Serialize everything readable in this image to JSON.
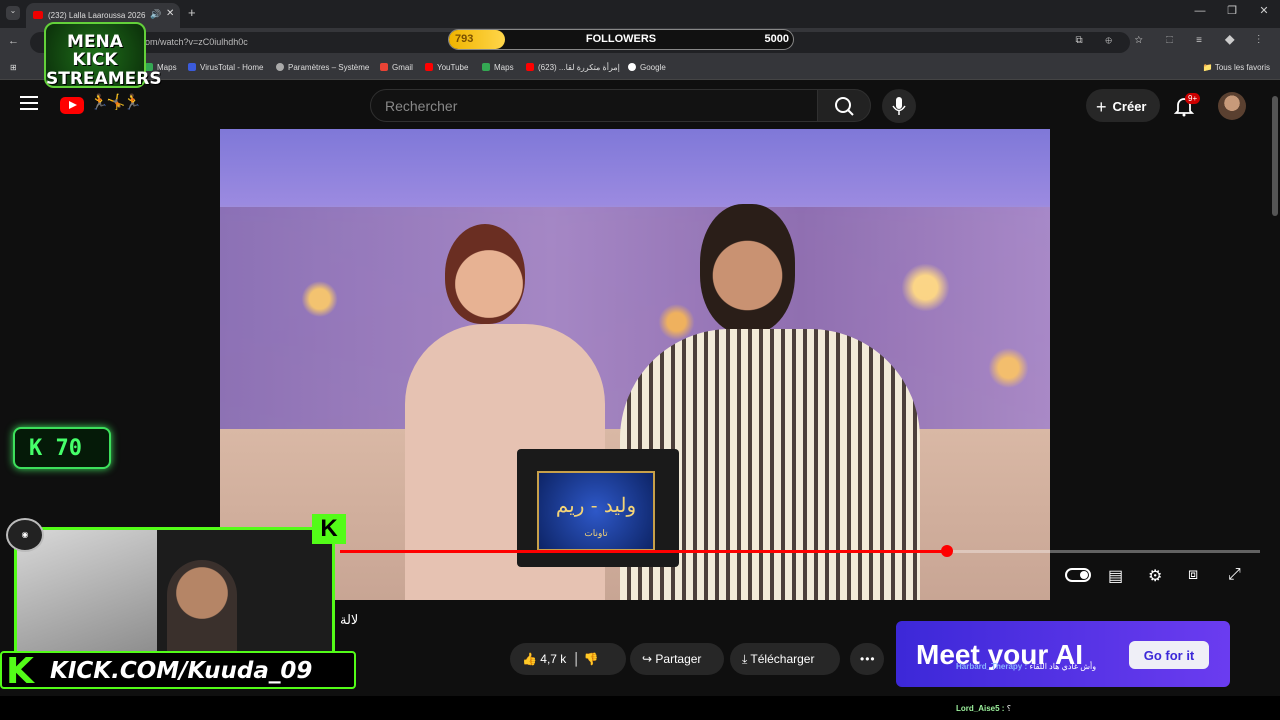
{
  "browser": {
    "tab_title": "(232) Lalla Laaroussa 2026 |",
    "url_visible": "om/watch?v=zC0iulhdh0c",
    "bookmarks": [
      "Maps",
      "VirusTotal - Home",
      "Paramètres – Système",
      "Gmail",
      "YouTube",
      "Maps",
      "إمرأة متكررة لقا... (623)",
      "Google"
    ],
    "all_bookmarks": "Tous les favoris"
  },
  "youtube": {
    "search_placeholder": "Rechercher",
    "create_label": "Créer",
    "notification_count": "9+",
    "video_title": "لالة",
    "sign_text": "وليد - ريم",
    "sign_sub": "تاونات",
    "likes": "4,7 k",
    "share_label": "Partager",
    "download_label": "Télécharger",
    "progress": 0.66
  },
  "ad": {
    "title": "Meet your AI",
    "cta": "Go for it"
  },
  "overlay": {
    "followers_current": "793",
    "followers_label": "FOLLOWERS",
    "followers_goal": "5000",
    "followers_fraction": 0.159,
    "mena_line1": "MENA KICK",
    "mena_line2": "STREAMERS",
    "kick_count": "70",
    "kick_url": "KICK.COM/Kuuda_09"
  },
  "chat": [
    {
      "user": "Harbard_Therapy :",
      "msg": "وأش غادي هاد اللقاء"
    },
    {
      "user": "Lord_Aise5 :",
      "msg": "؟"
    }
  ]
}
